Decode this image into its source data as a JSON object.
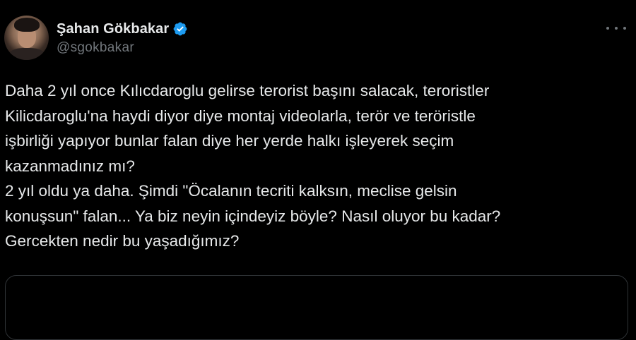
{
  "user": {
    "display_name": "Şahan Gökbakar",
    "handle": "@sgokbakar",
    "verified": true,
    "avatar_icon": "profile-photo"
  },
  "more_icon": "more-horizontal-icon",
  "tweet": {
    "lines": [
      "Daha 2 yıl once Kılıcdaroglu gelirse terorist başını salacak, teroristler",
      "Kilicdaroglu'na haydi diyor diye montaj videolarla, terör ve teröristle",
      "işbirliği yapıyor bunlar falan diye her yerde halkı işleyerek seçim",
      "kazanmadınız mı?",
      "2 yıl oldu ya daha. Şimdi \"Öcalanın tecriti kalksın, meclise gelsin",
      "konuşsun\" falan... Ya biz neyin içindeyiz böyle? Nasıl oluyor bu kadar?",
      "Gercekten nedir bu yaşadığımız?"
    ]
  },
  "colors": {
    "background": "#000000",
    "text_primary": "#e7e9ea",
    "text_secondary": "#71767b",
    "verified_badge": "#1d9bf0",
    "card_border": "#2f3336"
  }
}
